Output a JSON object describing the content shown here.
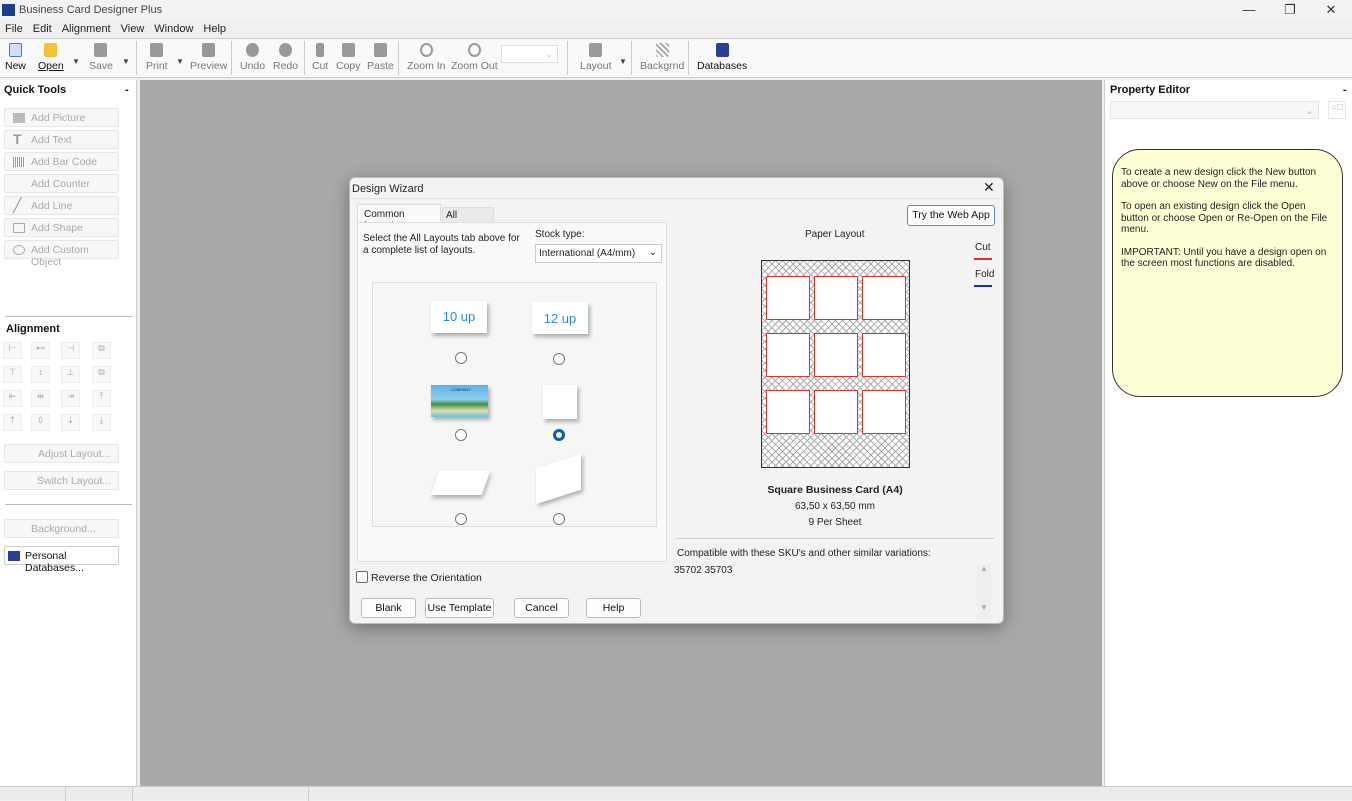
{
  "app": {
    "title": "Business Card Designer Plus",
    "window_controls": [
      "—",
      "❐",
      "✕"
    ]
  },
  "menu": [
    "File",
    "Edit",
    "Alignment",
    "View",
    "Window",
    "Help"
  ],
  "toolbar": {
    "new": "New",
    "open": "Open",
    "save": "Save",
    "print": "Print",
    "preview": "Preview",
    "undo": "Undo",
    "redo": "Redo",
    "cut": "Cut",
    "copy": "Copy",
    "paste": "Paste",
    "zoom_in": "Zoom In",
    "zoom_out": "Zoom Out",
    "zoom_value": "",
    "layout": "Layout",
    "backgrnd": "Backgrnd",
    "databases": "Databases"
  },
  "quick_tools": {
    "title": "Quick Tools",
    "collapse": "-",
    "items": [
      "Add Picture",
      "Add Text",
      "Add Bar Code",
      "Add Counter",
      "Add Line",
      "Add Shape",
      "Add Custom Object"
    ]
  },
  "alignment": {
    "title": "Alignment",
    "adjust_layout": "Adjust Layout...",
    "switch_layout": "Switch Layout...",
    "background": "Background...",
    "personal_databases": "Personal Databases..."
  },
  "property_editor": {
    "title": "Property Editor",
    "collapse": "-",
    "select_value": "",
    "note": [
      "To create a new design click the New button above or choose New on the File menu.",
      "To open an existing design click the Open button or choose Open or Re-Open on the File menu.",
      "IMPORTANT: Until you have a design open on the screen most functions are disabled."
    ]
  },
  "dialog": {
    "title": "Design Wizard",
    "close": "✕",
    "tabs": [
      "Common Layouts",
      "All Layouts"
    ],
    "instruction": "Select the All Layouts tab above for a complete list of layouts.",
    "stock_label": "Stock type:",
    "stock_value": "International (A4/mm)",
    "layouts": [
      {
        "label": "10 up",
        "selected": false
      },
      {
        "label": "12 up",
        "selected": false
      },
      {
        "label": "",
        "selected": false
      },
      {
        "label": "",
        "selected": true
      },
      {
        "label": "",
        "selected": false
      },
      {
        "label": "",
        "selected": false
      }
    ],
    "thumb_company": "COMPANY",
    "reverse_orientation": "Reverse the Orientation",
    "reverse_checked": false,
    "buttons": [
      "Blank",
      "Use Template",
      "Cancel",
      "Help"
    ],
    "try_web_app": "Try the Web App",
    "paper_layout": "Paper Layout",
    "legend_cut": "Cut",
    "legend_fold": "Fold",
    "cut_color": "#e0302a",
    "fold_color": "#1a2fb0",
    "card_name": "Square Business Card (A4)",
    "card_size": "63,50 x 63,50 mm",
    "per_sheet": "9 Per Sheet",
    "compat_label": "Compatible with these SKU's and other similar variations:",
    "skus": "35702 35703"
  }
}
